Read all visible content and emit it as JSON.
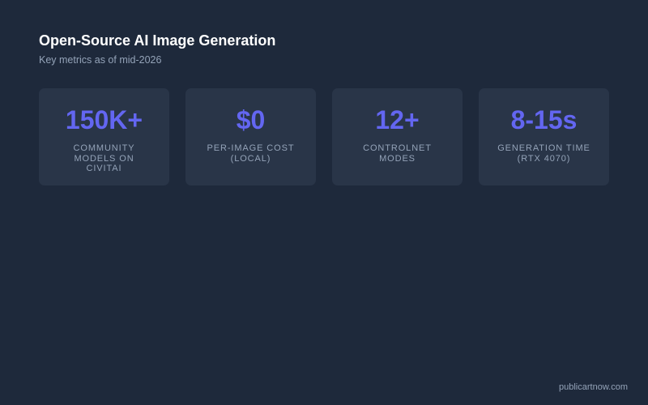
{
  "header": {
    "title": "Open-Source AI Image Generation",
    "subtitle": "Key metrics as of mid-2026"
  },
  "metrics": [
    {
      "value": "150K+",
      "label": "Community models on Civitai"
    },
    {
      "value": "$0",
      "label": "Per-image cost (local)"
    },
    {
      "value": "12+",
      "label": "ControlNet modes"
    },
    {
      "value": "8-15s",
      "label": "Generation time (RTX 4070)"
    }
  ],
  "footer": {
    "source": "publicartnow.com"
  },
  "colors": {
    "background": "#1e293b",
    "card": "#293548",
    "accent": "#6366f1",
    "muted_text": "#94a3b8",
    "heading_text": "#ffffff"
  }
}
